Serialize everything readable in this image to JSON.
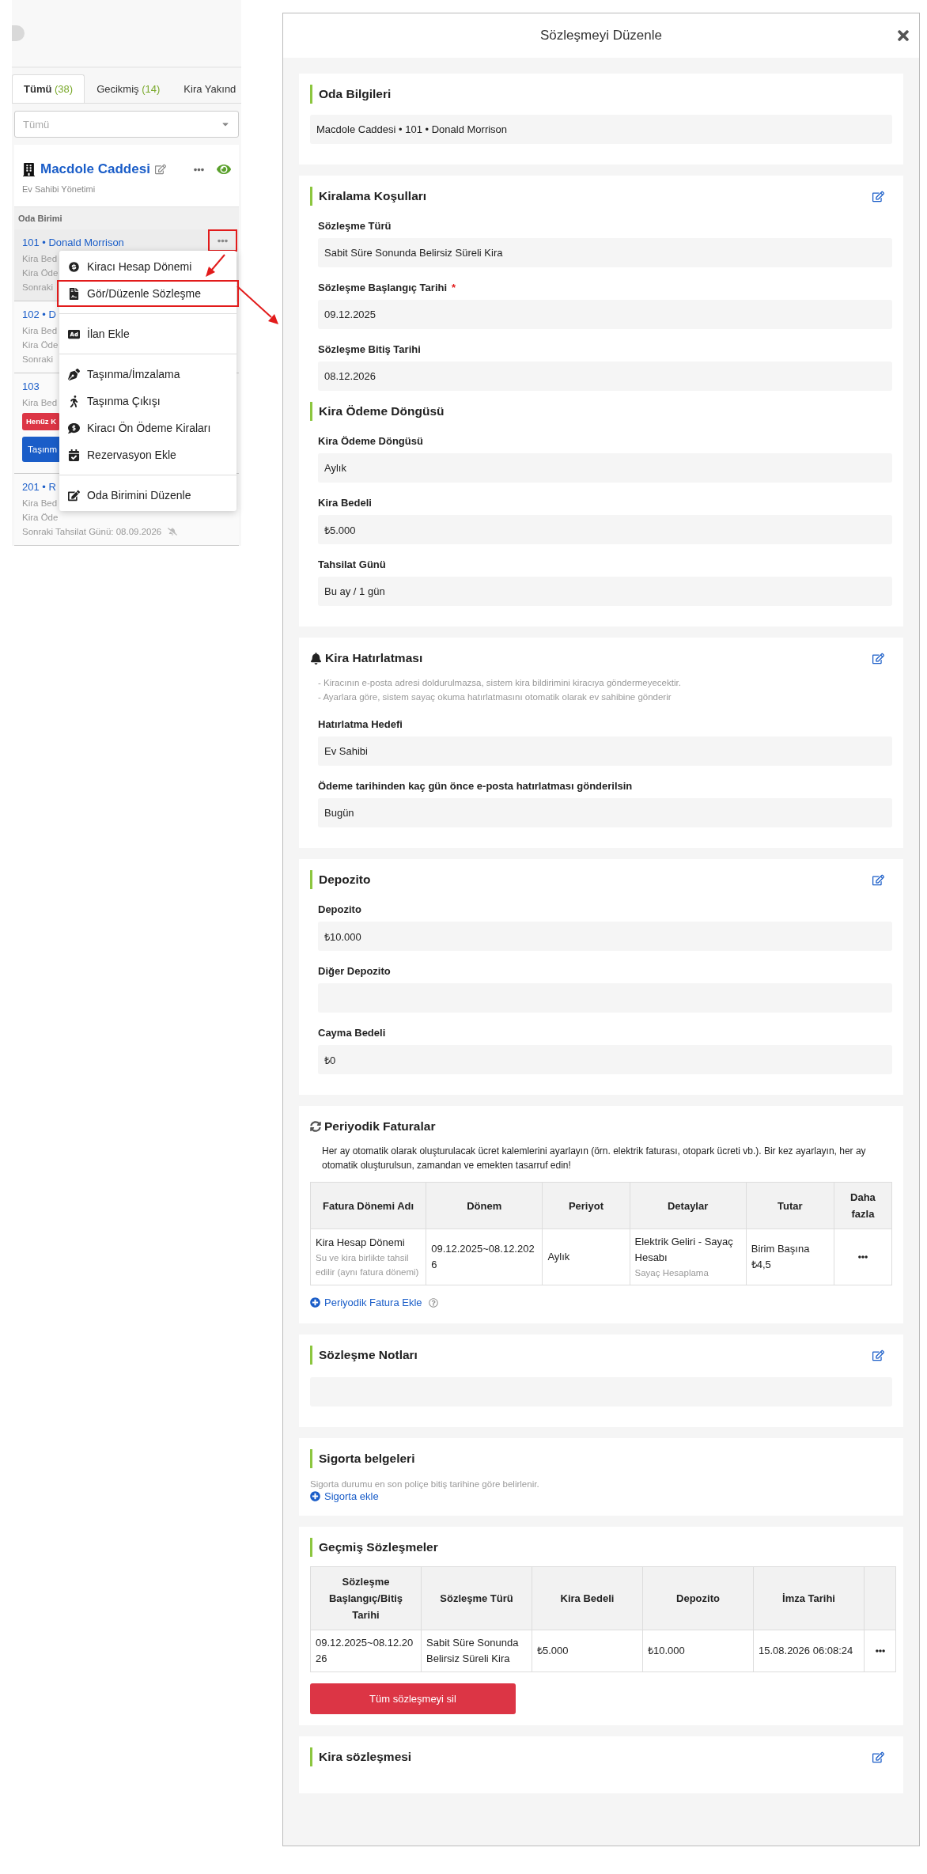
{
  "left_panel": {
    "tabs": [
      {
        "label": "Tümü",
        "count": "(38)",
        "selected": true
      },
      {
        "label": "Gecikmiş",
        "count": "(14)",
        "selected": false
      },
      {
        "label": "Kira Yakınd",
        "selected": false
      }
    ],
    "filter": {
      "placeholder": "Tümü"
    },
    "property": {
      "name": "Macdole Caddesi",
      "subtitle": "Ev Sahibi Yönetimi"
    },
    "units_header": "Oda Birimi",
    "units": [
      {
        "title": "101 • Donald Morrison",
        "selected": true,
        "menu_highlighted": true,
        "lines": [
          {
            "kind": "text",
            "text": "Kira Bed"
          },
          {
            "kind": "text",
            "text": "Kira Öde"
          },
          {
            "kind": "text",
            "text": "Sonraki"
          }
        ]
      },
      {
        "title": "102 • D",
        "selected": false,
        "menu_highlighted": false,
        "lines": [
          {
            "kind": "text",
            "text": "Kira Bed"
          },
          {
            "kind": "text",
            "text": "Kira Öde"
          },
          {
            "kind": "text",
            "text": "Sonraki"
          }
        ]
      },
      {
        "title": "103",
        "selected": false,
        "menu_highlighted": false,
        "lines": [
          {
            "kind": "text",
            "text": "Kira Bed"
          },
          {
            "kind": "badge",
            "text": "Henüz K"
          },
          {
            "kind": "button",
            "text": "Taşınm"
          }
        ]
      },
      {
        "title": "201 • R",
        "selected": false,
        "menu_highlighted": false,
        "lines": [
          {
            "kind": "text",
            "text": "Kira Bed"
          },
          {
            "kind": "text",
            "text": "Kira Öde"
          },
          {
            "kind": "reminder",
            "text": "Sonraki Tahsilat Günü:  08.09.2026"
          }
        ]
      }
    ],
    "context_menu": [
      [
        {
          "label": "Kiracı Hesap Dönemi",
          "highlighted": false
        },
        {
          "label": "Gör/Düzenle Sözleşme",
          "highlighted": true
        }
      ],
      [
        {
          "label": "İlan Ekle",
          "highlighted": false
        }
      ],
      [
        {
          "label": "Taşınma/İmzalama",
          "highlighted": false
        },
        {
          "label": "Taşınma Çıkışı",
          "highlighted": false
        },
        {
          "label": "Kiracı Ön Ödeme Kiraları",
          "highlighted": false
        },
        {
          "label": "Rezervasyon Ekle",
          "highlighted": false
        }
      ],
      [
        {
          "label": "Oda Birimini Düzenle",
          "highlighted": false
        }
      ]
    ]
  },
  "modal": {
    "title": "Sözleşmeyi Düzenle",
    "sections": [
      {
        "kind": "summary",
        "title": "Oda Bilgileri",
        "editable": false,
        "value": "Macdole Caddesi • 101 • Donald Morrison"
      },
      {
        "kind": "form",
        "title": "Kiralama Koşulları",
        "editable": true,
        "items": [
          {
            "kind": "field",
            "label": "Sözleşme Türü",
            "value": "Sabit Süre Sonunda Belirsiz Süreli Kira"
          },
          {
            "kind": "field",
            "label": "Sözleşme Başlangıç Tarihi",
            "value": "09.12.2025",
            "required_mark": "*"
          },
          {
            "kind": "field",
            "label": "Sözleşme Bitiş Tarihi",
            "value": "08.12.2026"
          },
          {
            "kind": "subheading",
            "label": "Kira Ödeme Döngüsü"
          },
          {
            "kind": "field",
            "label": "Kira Ödeme Döngüsü",
            "value": "Aylık"
          },
          {
            "kind": "field",
            "label": "Kira Bedeli",
            "value": "₺5.000"
          },
          {
            "kind": "field",
            "label": "Tahsilat Günü",
            "value": "Bu ay / 1 gün"
          }
        ]
      },
      {
        "kind": "reminder",
        "title": "Kira Hatırlatması",
        "editable": true,
        "notes": [
          "- Kiracının e-posta adresi doldurulmazsa, sistem kira bildirimini kiracıya göndermeyecektir.",
          "- Ayarlara göre, sistem sayaç okuma hatırlatmasını otomatik olarak ev sahibine gönderir"
        ],
        "items": [
          {
            "kind": "field",
            "label": "Hatırlatma Hedefi",
            "value": "Ev Sahibi"
          },
          {
            "kind": "field",
            "label": "Ödeme tarihinden kaç gün önce e-posta hatırlatması gönderilsin",
            "value": "Bugün"
          }
        ]
      },
      {
        "kind": "form",
        "title": "Depozito",
        "editable": true,
        "items": [
          {
            "kind": "field",
            "label": "Depozito",
            "value": "₺10.000"
          },
          {
            "kind": "field",
            "label": "Diğer Depozito"
          },
          {
            "kind": "field",
            "label": "Cayma Bedeli",
            "value": "₺0"
          }
        ]
      },
      {
        "kind": "invoices",
        "title": "Periyodik Faturalar",
        "editable": false,
        "description": "Her ay otomatik olarak oluşturulacak ücret kalemlerini ayarlayın (örn. elektrik faturası, otopark ücreti vb.). Bir kez ayarlayın, her ay otomatik oluşturulsun, zamandan ve emekten tasarruf edin!",
        "columns": [
          "Fatura Dönemi Adı",
          "Dönem",
          "Periyot",
          "Detaylar",
          "Tutar",
          "Daha fazla"
        ],
        "rows": [
          [
            {
              "text": "Kira Hesap Dönemi",
              "sub": "Su ve kira birlikte tahsil edilir (aynı fatura dönemi)"
            },
            {
              "text": "09.12.2025~08.12.2026"
            },
            {
              "text": "Aylık"
            },
            {
              "text": "Elektrik Geliri - Sayaç Hesabı",
              "sub": "Sayaç Hesaplama"
            },
            {
              "text": "Birim Başına ₺4,5"
            }
          ]
        ],
        "add_link": "Periyodik Fatura Ekle"
      },
      {
        "kind": "notes",
        "title": "Sözleşme Notları",
        "editable": true
      },
      {
        "kind": "insurance",
        "title": "Sigorta belgeleri",
        "editable": false,
        "note": "Sigorta durumu en son poliçe bitiş tarihine göre belirlenir.",
        "add_link": "Sigorta ekle"
      },
      {
        "kind": "history",
        "title": "Geçmiş Sözleşmeler",
        "editable": false,
        "columns": [
          "Sözleşme Başlangıç/Bitiş Tarihi",
          "Sözleşme Türü",
          "Kira Bedeli",
          "Depozito",
          "İmza Tarihi"
        ],
        "rows": [
          [
            "09.12.2025~08.12.2026",
            "Sabit Süre Sonunda Belirsiz Süreli Kira",
            "₺5.000",
            "₺10.000",
            "15.08.2026 06:08:24"
          ]
        ],
        "delete_button": "Tüm sözleşmeyi sil"
      },
      {
        "kind": "plain",
        "title": "Kira sözleşmesi",
        "editable": true
      }
    ]
  }
}
